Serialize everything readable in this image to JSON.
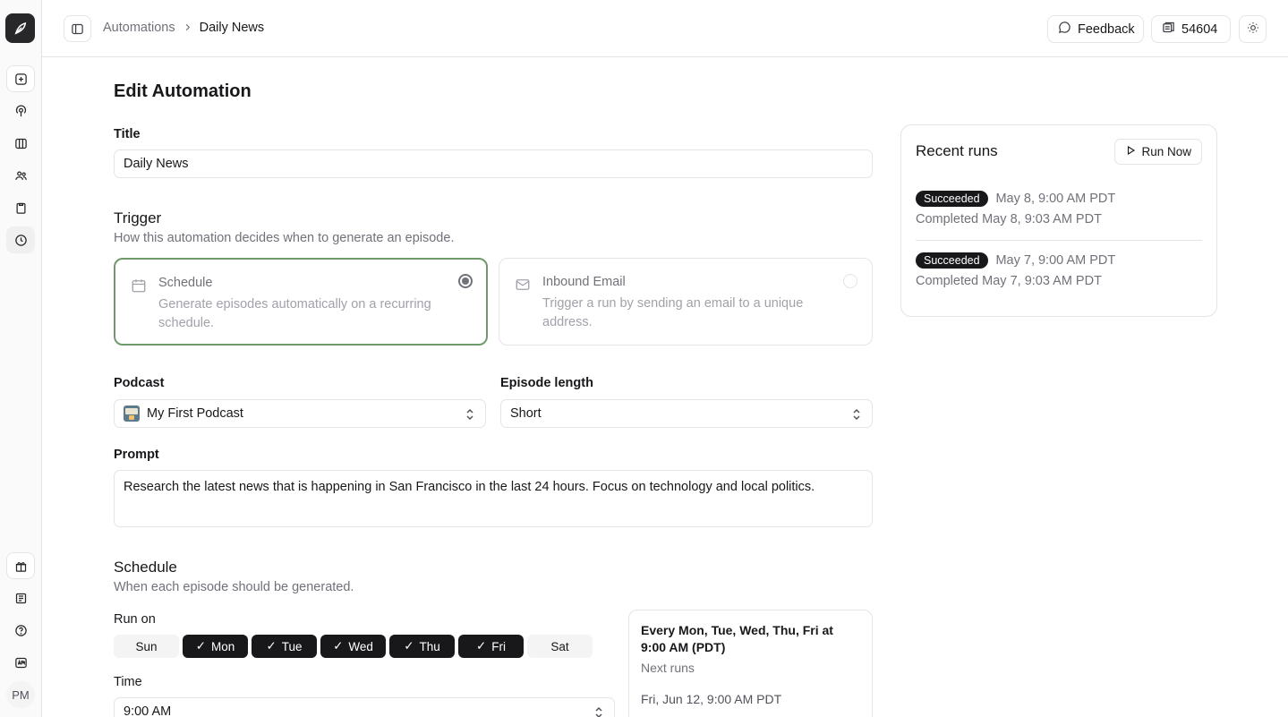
{
  "rail": {
    "logo": "logo-icon",
    "items": [
      {
        "icon": "add-square-icon"
      },
      {
        "icon": "podcast-icon"
      },
      {
        "icon": "library-icon"
      },
      {
        "icon": "users-icon"
      },
      {
        "icon": "clipboard-icon"
      },
      {
        "icon": "automation-clock-icon"
      }
    ],
    "bottom_items": [
      {
        "icon": "gift-icon"
      },
      {
        "icon": "newspaper-icon"
      },
      {
        "icon": "help-icon"
      },
      {
        "icon": "api-icon"
      }
    ],
    "avatar_initials": "PM"
  },
  "topbar": {
    "breadcrumb": [
      "Automations",
      "Daily News"
    ],
    "feedback_label": "Feedback",
    "credits": "54604"
  },
  "page": {
    "heading": "Edit Automation",
    "title_label": "Title",
    "title_value": "Daily News",
    "trigger": {
      "heading": "Trigger",
      "subtitle": "How this automation decides when to generate an episode.",
      "options": [
        {
          "name": "Schedule",
          "desc": "Generate episodes automatically on a recurring schedule.",
          "selected": true
        },
        {
          "name": "Inbound Email",
          "desc": "Trigger a run by sending an email to a unique address.",
          "selected": false
        }
      ]
    },
    "podcast_label": "Podcast",
    "podcast_value": "My First Podcast",
    "episode_length_label": "Episode length",
    "episode_length_value": "Short",
    "prompt_label": "Prompt",
    "prompt_value": "Research the latest news that is happening in San Francisco in the last 24 hours. Focus on technology and local politics.",
    "schedule": {
      "heading": "Schedule",
      "subtitle": "When each episode should be generated.",
      "run_on_label": "Run on",
      "days": [
        {
          "label": "Sun",
          "on": false
        },
        {
          "label": "Mon",
          "on": true
        },
        {
          "label": "Tue",
          "on": true
        },
        {
          "label": "Wed",
          "on": true
        },
        {
          "label": "Thu",
          "on": true
        },
        {
          "label": "Fri",
          "on": true
        },
        {
          "label": "Sat",
          "on": false
        }
      ],
      "time_label": "Time",
      "time_value": "9:00 AM",
      "summary": "Every Mon, Tue, Wed, Thu, Fri at 9:00 AM (PDT)",
      "next_runs_label": "Next runs",
      "next_run": "Fri, Jun 12, 9:00 AM PDT"
    }
  },
  "recent_runs": {
    "title": "Recent runs",
    "run_now_label": "Run Now",
    "runs": [
      {
        "status": "Succeeded",
        "started": "May 8, 9:00 AM PDT",
        "completed": "Completed May 8, 9:03 AM PDT"
      },
      {
        "status": "Succeeded",
        "started": "May 7, 9:00 AM PDT",
        "completed": "Completed May 7, 9:03 AM PDT"
      }
    ]
  }
}
